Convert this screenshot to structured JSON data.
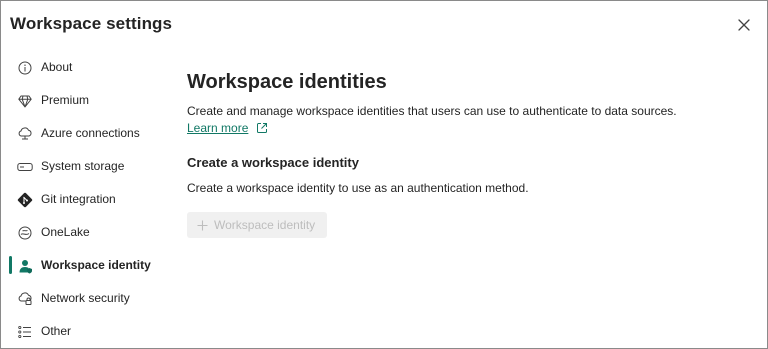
{
  "dialog": {
    "title": "Workspace settings",
    "close_icon": "close-icon"
  },
  "sidebar": {
    "items": [
      {
        "label": "About",
        "icon": "info-icon",
        "active": false
      },
      {
        "label": "Premium",
        "icon": "diamond-icon",
        "active": false
      },
      {
        "label": "Azure connections",
        "icon": "cloud-connection-icon",
        "active": false
      },
      {
        "label": "System storage",
        "icon": "storage-icon",
        "active": false
      },
      {
        "label": "Git integration",
        "icon": "git-icon",
        "active": false
      },
      {
        "label": "OneLake",
        "icon": "onelake-icon",
        "active": false
      },
      {
        "label": "Workspace identity",
        "icon": "identity-icon",
        "active": true
      },
      {
        "label": "Network security",
        "icon": "network-security-icon",
        "active": false
      },
      {
        "label": "Other",
        "icon": "list-icon",
        "active": false
      }
    ]
  },
  "main": {
    "heading": "Workspace identities",
    "description": "Create and manage workspace identities that users can use to authenticate to data sources.",
    "learn_more": "Learn more",
    "section_heading": "Create a workspace identity",
    "section_description": "Create a workspace identity to use as an authentication method.",
    "add_button_label": "Workspace identity",
    "add_button_enabled": false
  },
  "colors": {
    "accent": "#117865",
    "text": "#242424",
    "disabled_text": "#bdbdbd",
    "disabled_bg": "#f0f0f0"
  }
}
